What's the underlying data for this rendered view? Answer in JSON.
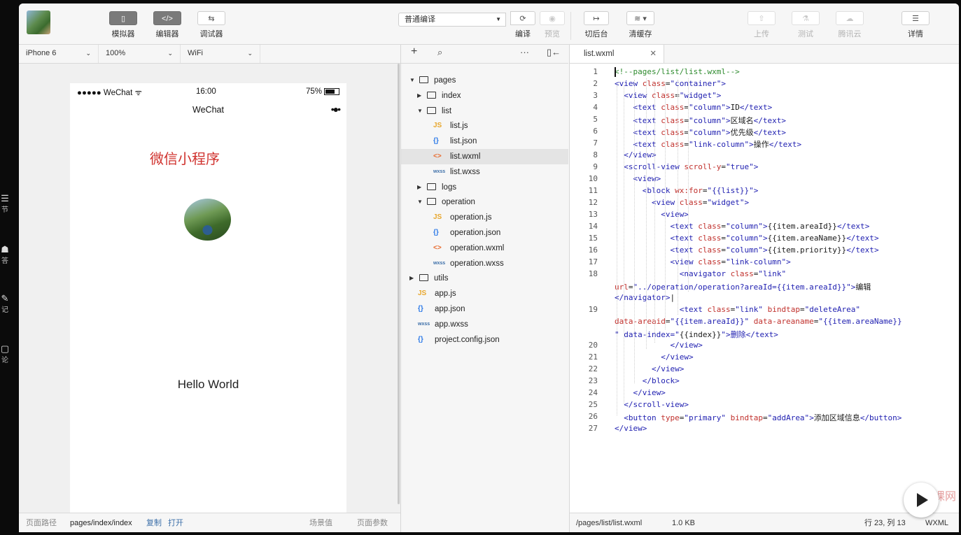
{
  "left_strip": [
    {
      "glyph": "☰",
      "label": "节"
    },
    {
      "glyph": "☗",
      "label": "答"
    },
    {
      "glyph": "✎",
      "label": "记"
    },
    {
      "glyph": "▢",
      "label": "论"
    }
  ],
  "toolbar": {
    "simulator": {
      "icon": "phone-icon",
      "label": "模拟器"
    },
    "editor": {
      "icon": "code-icon",
      "label": "编辑器"
    },
    "debugger": {
      "icon": "debug-icon",
      "label": "调试器"
    },
    "compile_mode": "普通编译",
    "compile": "编译",
    "preview": "预览",
    "background": "切后台",
    "clear_cache": "清缓存",
    "upload": "上传",
    "test": "测试",
    "tencent_cloud": "腾讯云",
    "details": "详情"
  },
  "sim_settings": {
    "device": "iPhone 6",
    "zoom": "100%",
    "network": "WiFi"
  },
  "phone": {
    "carrier": "●●●●● WeChat ᯤ",
    "time": "16:00",
    "battery": "75%",
    "nav_title": "WeChat",
    "nav_dots": "•●•",
    "heading": "微信小程序",
    "hello": "Hello World"
  },
  "sim_footer": {
    "path_label": "页面路径",
    "path": "pages/index/index",
    "copy": "复制",
    "open": "打开",
    "scene": "场景值",
    "params": "页面参数"
  },
  "tree": {
    "items": [
      {
        "name": "pages",
        "type": "folder",
        "open": true
      },
      {
        "name": "index",
        "type": "folder",
        "open": false
      },
      {
        "name": "list",
        "type": "folder",
        "open": true
      },
      {
        "name": "list.js",
        "type": "js"
      },
      {
        "name": "list.json",
        "type": "json"
      },
      {
        "name": "list.wxml",
        "type": "wxml"
      },
      {
        "name": "list.wxss",
        "type": "wxss"
      },
      {
        "name": "logs",
        "type": "folder",
        "open": false
      },
      {
        "name": "operation",
        "type": "folder",
        "open": true
      },
      {
        "name": "operation.js",
        "type": "js"
      },
      {
        "name": "operation.json",
        "type": "json"
      },
      {
        "name": "operation.wxml",
        "type": "wxml"
      },
      {
        "name": "operation.wxss",
        "type": "wxss"
      },
      {
        "name": "utils",
        "type": "folder",
        "open": false
      },
      {
        "name": "app.js",
        "type": "js"
      },
      {
        "name": "app.json",
        "type": "json"
      },
      {
        "name": "app.wxss",
        "type": "wxss"
      },
      {
        "name": "project.config.json",
        "type": "json"
      }
    ],
    "icons": {
      "js": "JS",
      "json": "{}",
      "wxml": "<>",
      "wxss": "wxss"
    }
  },
  "editor": {
    "tab": "list.wxml",
    "lines": [
      {
        "n": "1",
        "text": "<!--pages/list/list.wxml-->"
      },
      {
        "n": "2",
        "text": "<view class=\"container\">"
      },
      {
        "n": "3",
        "text": "  <view class=\"widget\">"
      },
      {
        "n": "4",
        "text": "    <text class=\"column\">ID</text>"
      },
      {
        "n": "5",
        "text": "    <text class=\"column\">区域名</text>"
      },
      {
        "n": "6",
        "text": "    <text class=\"column\">优先级</text>"
      },
      {
        "n": "7",
        "text": "    <text class=\"link-column\">操作</text>"
      },
      {
        "n": "8",
        "text": "  </view>"
      },
      {
        "n": "9",
        "text": "  <scroll-view scroll-y=\"true\">"
      },
      {
        "n": "10",
        "text": "    <view>"
      },
      {
        "n": "11",
        "text": "      <block wx:for=\"{{list}}\">"
      },
      {
        "n": "12",
        "text": "        <view class=\"widget\">"
      },
      {
        "n": "13",
        "text": "          <view>"
      },
      {
        "n": "14",
        "text": "            <text class=\"column\">{{item.areaId}}</text>"
      },
      {
        "n": "15",
        "text": "            <text class=\"column\">{{item.areaName}}</text>"
      },
      {
        "n": "16",
        "text": "            <text class=\"column\">{{item.priority}}</text>"
      },
      {
        "n": "17",
        "text": "            <view class=\"link-column\">"
      },
      {
        "n": "18",
        "text": "              <navigator class=\"link\""
      },
      {
        "n": "",
        "text": "url=\"../operation/operation?areaId={{item.areaId}}\">编辑"
      },
      {
        "n": "",
        "text": "</navigator>|"
      },
      {
        "n": "19",
        "text": "              <text class=\"link\" bindtap=\"deleteArea\""
      },
      {
        "n": "",
        "text": "data-areaid=\"{{item.areaId}}\" data-areaname=\"{{item.areaName}}"
      },
      {
        "n": "",
        "text": "\" data-index=\"{{index}}\">删除</text>"
      },
      {
        "n": "20",
        "text": "            </view>"
      },
      {
        "n": "21",
        "text": "          </view>"
      },
      {
        "n": "22",
        "text": "        </view>"
      },
      {
        "n": "23",
        "text": "      </block>"
      },
      {
        "n": "24",
        "text": "    </view>"
      },
      {
        "n": "25",
        "text": "  </scroll-view>"
      },
      {
        "n": "26",
        "text": "  <button type=\"primary\" bindtap=\"addArea\">添加区域信息</button>"
      },
      {
        "n": "27",
        "text": "</view>"
      }
    ]
  },
  "editor_footer": {
    "path": "/pages/list/list.wxml",
    "size": "1.0 KB",
    "position": "行 23, 列 13",
    "lang": "WXML"
  },
  "watermark": "慕课网",
  "colors": {
    "tag": "#1e1eb0",
    "attr": "#c0302c",
    "comment": "#2e8b2e",
    "heading": "#d0312d"
  }
}
